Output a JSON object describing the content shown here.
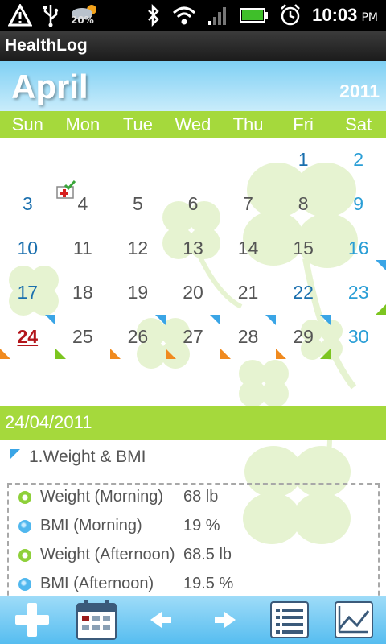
{
  "status_bar": {
    "battery_badge": "20%",
    "time": "10:03",
    "ampm": "PM",
    "icons": [
      "alert-icon",
      "usb-icon",
      "weather-icon",
      "bluetooth-icon",
      "wifi-icon",
      "signal-icon",
      "battery-icon",
      "alarm-icon"
    ]
  },
  "app": {
    "title": "HealthLog"
  },
  "calendar": {
    "month": "April",
    "year": "2011",
    "weekdays": [
      "Sun",
      "Mon",
      "Tue",
      "Wed",
      "Thu",
      "Fri",
      "Sat"
    ],
    "days": [
      "1",
      "2",
      "3",
      "4",
      "5",
      "6",
      "7",
      "8",
      "9",
      "10",
      "11",
      "12",
      "13",
      "14",
      "15",
      "16",
      "17",
      "18",
      "19",
      "20",
      "21",
      "22",
      "23",
      "24",
      "25",
      "26",
      "27",
      "28",
      "29",
      "30"
    ],
    "selected_day": "24"
  },
  "selected_date": "24/04/2011",
  "record_section": {
    "title": "1.Weight & BMI",
    "items": [
      {
        "label": "Weight (Morning)",
        "value": "68 lb",
        "marker": "green"
      },
      {
        "label": "BMI (Morning)",
        "value": "19 %",
        "marker": "blue"
      },
      {
        "label": "Weight (Afternoon)",
        "value": "68.5 lb",
        "marker": "green"
      },
      {
        "label": "BMI (Afternoon)",
        "value": "19.5 %",
        "marker": "blue"
      }
    ]
  },
  "toolbar": {
    "buttons": [
      "add-icon",
      "calendar-icon",
      "prev-arrow-icon",
      "next-arrow-icon",
      "list-icon",
      "chart-icon"
    ]
  },
  "colors": {
    "accent_green": "#a5d93c",
    "accent_blue": "#7fd0f4",
    "today_red": "#b3151b",
    "weekend_blue": "#2a9ed6"
  }
}
